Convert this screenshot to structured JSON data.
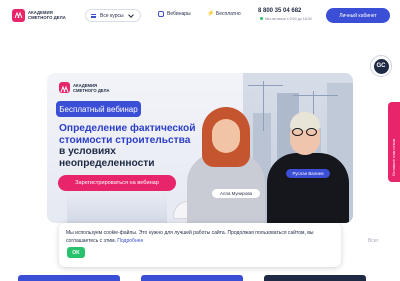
{
  "header": {
    "logo_line1": "АКАДЕМИЯ",
    "logo_line2": "СМЕТНОГО ДЕЛА",
    "courses_label": "Все курсы",
    "nav_webinars": "Вебинары",
    "nav_free": "Бесплатно",
    "phone": "8 800 35 04 682",
    "hours": "Мы на связи с 9:00 до 18:00",
    "cabinet_label": "Личный кабинет"
  },
  "widgets": {
    "gc_label": "GC",
    "side_tab_label": "Оставьте нам отзыв"
  },
  "banner": {
    "logo_line1": "АКАДЕМИЯ",
    "logo_line2": "СМЕТНОГО ДЕЛА",
    "badge": "Бесплатный вебинар",
    "title_line1": "Определение фактической",
    "title_line2": "стоимости строительства",
    "title_line3": "в условиях",
    "title_line4": "неопределенности",
    "register_label": "Зарегистрироваться на вебинар",
    "speaker1": "Алла Мунирова",
    "speaker2": "Руслан Валиев"
  },
  "cookie": {
    "text": "Мы используем cookie-файлы. Это нужно для лучшей работы сайта. Продолжая пользоваться сайтом, вы соглашаетесь с этим.",
    "link_label": "Подробнее",
    "ok_label": "OK"
  },
  "more_label": "Всег",
  "colors": {
    "brand_pink": "#e8246b",
    "brand_blue": "#3b4ed6",
    "ok_green": "#27c26b"
  }
}
